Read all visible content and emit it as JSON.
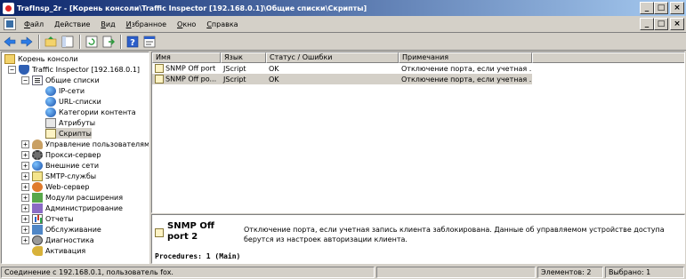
{
  "window": {
    "title": "TrafInsp_2r - [Корень консоли\\Traffic Inspector [192.168.0.1]\\Общие списки\\Скрипты]",
    "minimize": "_",
    "maximize": "□",
    "close": "×"
  },
  "menu": {
    "items": [
      "Файл",
      "Действие",
      "Вид",
      "Избранное",
      "Окно",
      "Справка"
    ]
  },
  "toolbar": {
    "icons": [
      "back-icon",
      "forward-icon",
      "up-folder-icon",
      "show-tree-icon",
      "refresh-icon",
      "export-icon",
      "help-icon",
      "properties-icon"
    ]
  },
  "tree": {
    "root": "Корень консоли",
    "server": "Traffic Inspector [192.168.0.1]",
    "common_lists": "Общие списки",
    "children": [
      "IP-сети",
      "URL-списки",
      "Категории контента",
      "Атрибуты",
      "Скрипты"
    ],
    "sections": [
      "Управление пользователями",
      "Прокси-сервер",
      "Внешние сети",
      "SMTP-службы",
      "Web-сервер",
      "Модули расширения",
      "Администрирование",
      "Отчеты",
      "Обслуживание",
      "Диагностика",
      "Активация"
    ]
  },
  "list": {
    "columns": [
      "Имя",
      "Язык",
      "Статус / Ошибки",
      "Примечания"
    ],
    "rows": [
      {
        "name": "SNMP Off port",
        "lang": "JScript",
        "status": "OK",
        "note": "Отключение порта, если учетная ..."
      },
      {
        "name": "SNMP Off po...",
        "lang": "JScript",
        "status": "OK",
        "note": "Отключение порта, если учетная ..."
      }
    ]
  },
  "details": {
    "title": "SNMP Off port 2",
    "description": "Отключение порта, если учетная запись клиента заблокирована. Данные об управляемом устройстве доступа берутся из настроек авторизации клиента.",
    "procedures": "Procedures: 1 (Main)"
  },
  "status": {
    "connection": "Соединение с 192.168.0.1, пользователь fox.",
    "blank": "",
    "elements": "Элементов: 2",
    "selected": "Выбрано: 1"
  }
}
